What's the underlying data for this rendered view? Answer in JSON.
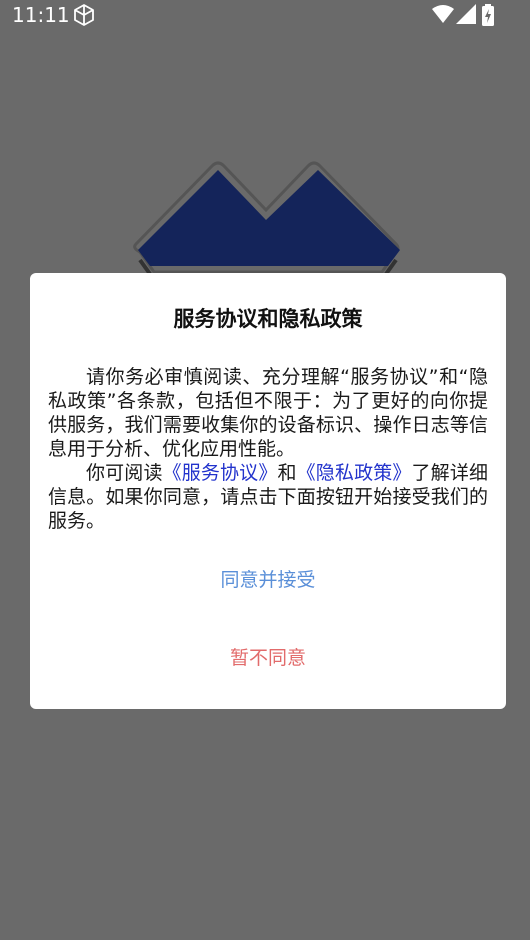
{
  "status_bar": {
    "time": "11:11"
  },
  "dialog": {
    "title": "服务协议和隐私政策",
    "paragraph1": "请你务必审慎阅读、充分理解“服务协议”和“隐私政策”各条款，包括但不限于：为了更好的向你提供服务，我们需要收集你的设备标识、操作日志等信息用于分析、优化应用性能。",
    "p2_prefix": "你可阅读",
    "p2_link_service": "《服务协议》",
    "p2_and": "和",
    "p2_link_privacy": "《隐私政策》",
    "p2_suffix": "了解详细信息。如果你同意，请点击下面按钮开始接受我们的服务。",
    "accept_label": "同意并接受",
    "decline_label": "暂不同意"
  },
  "colors": {
    "overlay": "#6a6a6a",
    "logo": "#14245a",
    "link": "#2233cc",
    "accept": "#5a8fd8",
    "decline": "#e26b6b"
  }
}
